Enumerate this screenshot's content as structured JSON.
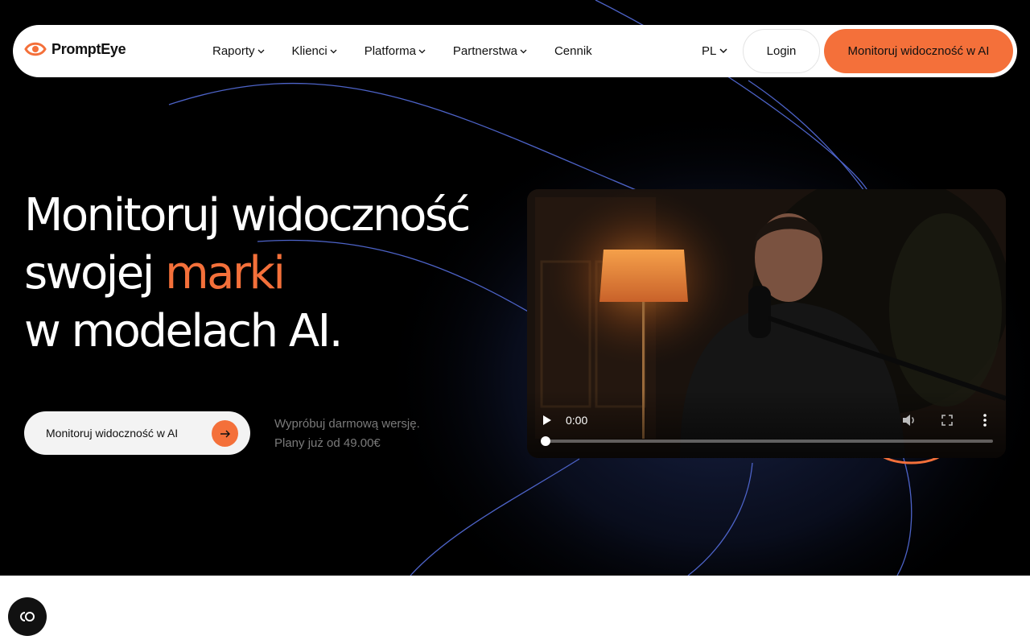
{
  "brand": {
    "name": "PromptEye",
    "accent": "#f4703a"
  },
  "nav": {
    "items": [
      {
        "label": "Raporty",
        "dropdown": true
      },
      {
        "label": "Klienci",
        "dropdown": true
      },
      {
        "label": "Platforma",
        "dropdown": true
      },
      {
        "label": "Partnerstwa",
        "dropdown": true
      },
      {
        "label": "Cennik",
        "dropdown": false
      }
    ],
    "language": "PL",
    "login": "Login",
    "cta": "Monitoruj widoczność w AI"
  },
  "hero": {
    "line1": "Monitoruj widoczność",
    "line2_prefix": "swojej ",
    "line2_accent": "marki",
    "line3": "w modelach AI.",
    "cta": "Monitoruj widoczność w AI",
    "try_line1": "Wypróbuj darmową wersję.",
    "try_line2": "Plany już od 49.00€"
  },
  "video": {
    "time": "0:00",
    "progress": 0,
    "icons": [
      "play-icon",
      "volume-icon",
      "fullscreen-icon",
      "more-options-icon"
    ]
  },
  "widget": {
    "icon": "cookie-consent-icon"
  }
}
